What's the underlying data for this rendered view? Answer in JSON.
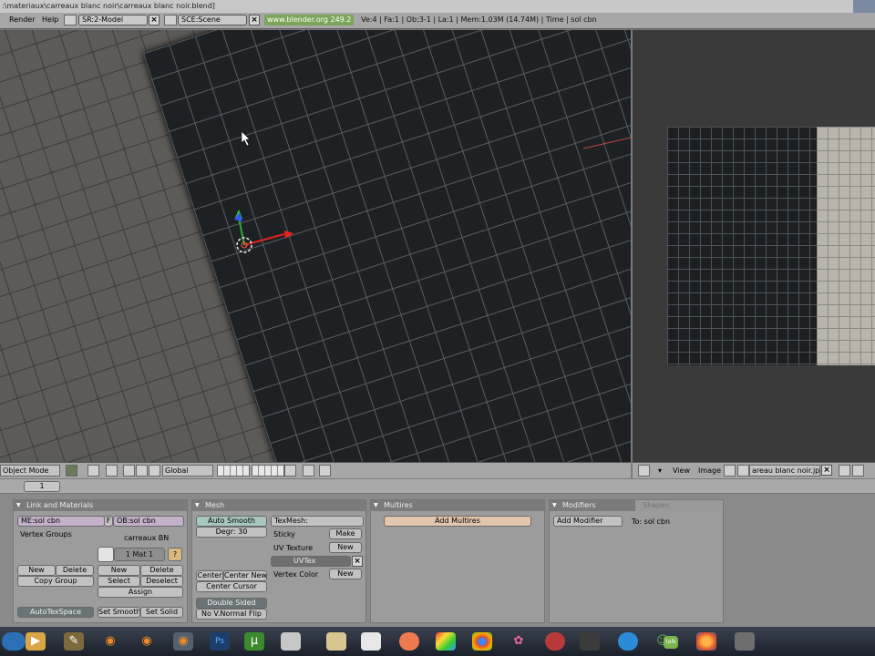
{
  "window": {
    "title_path": ":\\materiaux\\carreaux blanc noir\\carreaux blanc noir.blend]"
  },
  "top_header": {
    "menus": [
      "Render",
      "Help"
    ],
    "screen_field": "SR:2-Model",
    "scene_field": "SCE:Scene",
    "url": "www.blender.org 249.2",
    "stats": "Ve:4 | Fa:1 | Ob:3-1 | La:1  | Mem:1.03M (14.74M) | Time | sol cbn"
  },
  "viewport_header": {
    "mode": "Object Mode",
    "orientation": "Global"
  },
  "image_header": {
    "menus": [
      "View",
      "Image"
    ],
    "image_name": "areau blanc noir.jpg"
  },
  "buttons_header": {
    "frame": "1"
  },
  "panels": {
    "link_materials": {
      "title": "Link and Materials",
      "mesh_name": "ME:sol cbn",
      "f_label": "F",
      "object_name": "OB:sol cbn",
      "vertex_groups": "Vertex Groups",
      "material_name": "carreaux BN",
      "mat_index": "1 Mat 1",
      "question": "?",
      "vg_new": "New",
      "vg_delete": "Delete",
      "copy_group": "Copy Group",
      "mat_new": "New",
      "mat_delete": "Delete",
      "select": "Select",
      "deselect": "Deselect",
      "assign": "Assign",
      "autotexspace": "AutoTexSpace",
      "set_smooth": "Set Smooth",
      "set_solid": "Set Solid"
    },
    "mesh": {
      "title": "Mesh",
      "auto_smooth": "Auto Smooth",
      "degr": "Degr: 30",
      "texmesh": "TexMesh:",
      "sticky": "Sticky",
      "make": "Make",
      "uv_texture": "UV Texture",
      "new1": "New",
      "uvtex": "UVTex",
      "vertex_color": "Vertex Color",
      "new2": "New",
      "center": "Center",
      "center_new": "Center New",
      "center_cursor": "Center Cursor",
      "double_sided": "Double Sided",
      "no_v_normal_flip": "No V.Normal Flip"
    },
    "multires": {
      "title": "Multires",
      "add_multires": "Add Multires"
    },
    "modifiers": {
      "tab_modifiers": "Modifiers",
      "tab_shapes": "Shapes",
      "add_modifier": "Add Modifier",
      "to_label": "To: sol cbn"
    }
  },
  "taskbar": {
    "icons": [
      "start-orb-icon",
      "folder-icon",
      "blender-icon",
      "blender-icon",
      "blender-icon",
      "blender-icon",
      "photoshop-icon",
      "utorrent-icon",
      "explorer-icon",
      "document-icon",
      "paint-icon",
      "color-icon",
      "chrome-icon",
      "flower-icon",
      "media-icon",
      "dictionary-icon",
      "skype-icon",
      "msn-icon",
      "talk-icon",
      "firefox-icon",
      "user-icon"
    ]
  }
}
